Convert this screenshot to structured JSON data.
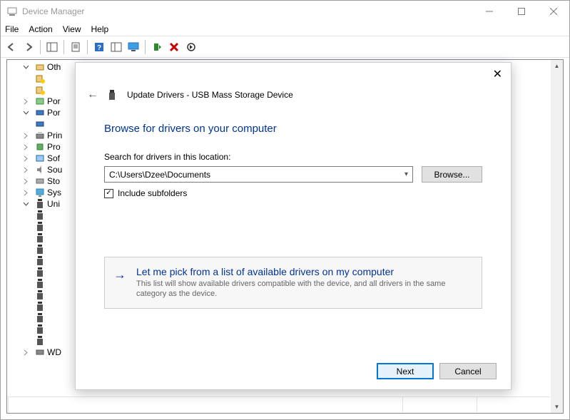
{
  "window": {
    "title": "Device Manager"
  },
  "menu": {
    "file": "File",
    "action": "Action",
    "view": "View",
    "help": "Help"
  },
  "tree": {
    "items": [
      {
        "exp": "expanded",
        "label": "Oth"
      },
      {
        "exp": "none",
        "label": "Por",
        "child": false
      },
      {
        "exp": "expanded",
        "label": "Por"
      },
      {
        "exp": "none",
        "label": "Prin"
      },
      {
        "exp": "none",
        "label": "Pro"
      },
      {
        "exp": "none",
        "label": "Sof"
      },
      {
        "exp": "none",
        "label": "Sou"
      },
      {
        "exp": "none",
        "label": "Sto"
      },
      {
        "exp": "none",
        "label": "Sys"
      },
      {
        "exp": "expanded",
        "label": "Uni"
      }
    ],
    "wd_label": "WD"
  },
  "modal": {
    "title": "Update Drivers - USB Mass Storage Device",
    "heading": "Browse for drivers on your computer",
    "search_label": "Search for drivers in this location:",
    "path_value": "C:\\Users\\Dzee\\Documents",
    "browse_label": "Browse...",
    "include_subfolders": "Include subfolders",
    "option": {
      "title": "Let me pick from a list of available drivers on my computer",
      "desc": "This list will show available drivers compatible with the device, and all drivers in the same category as the device."
    },
    "next": "Next",
    "cancel": "Cancel"
  }
}
